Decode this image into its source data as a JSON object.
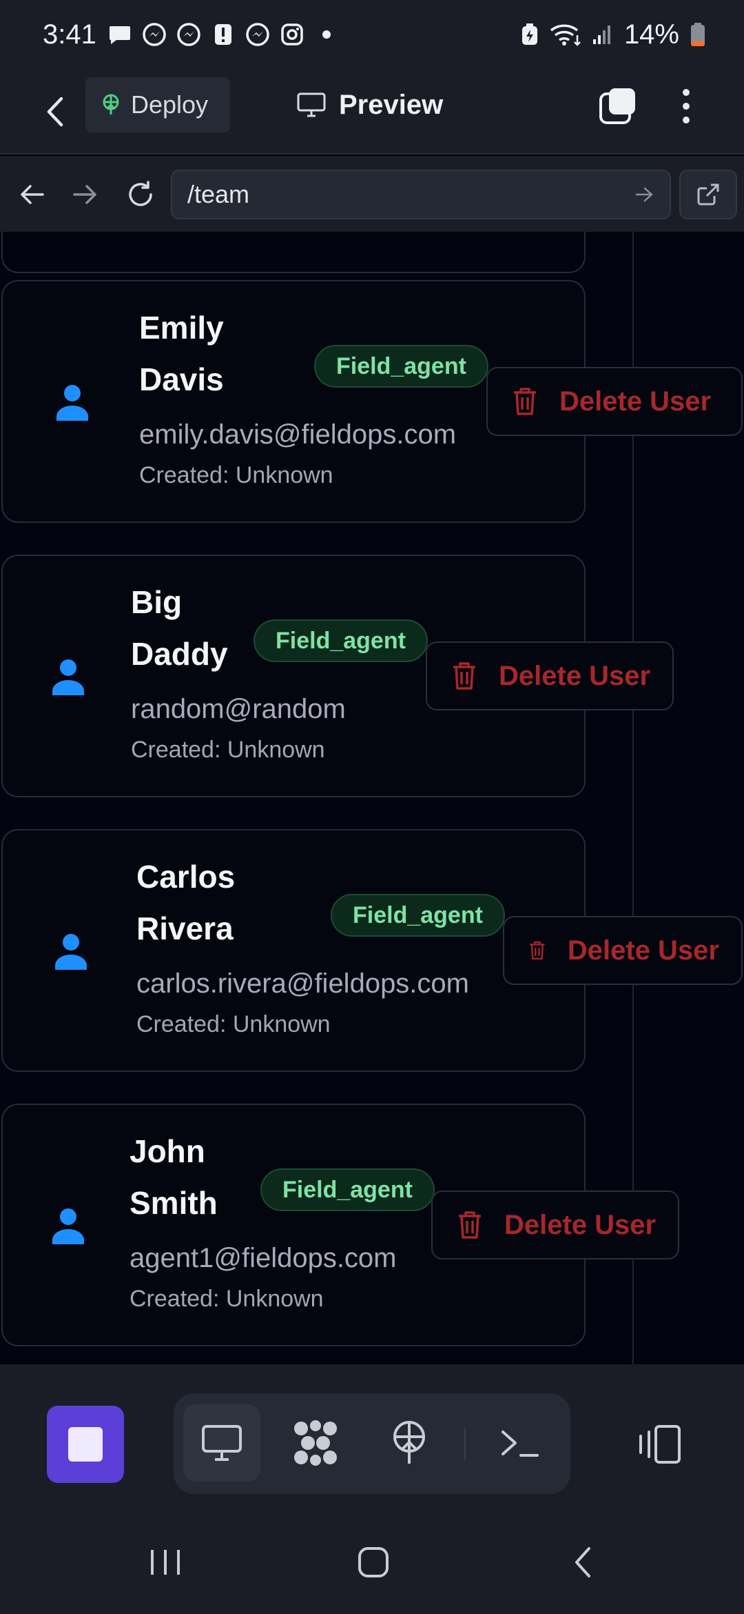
{
  "status_bar": {
    "time": "3:41",
    "notification_icons": [
      "chat-bubble-icon",
      "messenger-icon",
      "messenger-icon",
      "alert-icon",
      "messenger-icon",
      "instagram-icon",
      "dot-icon"
    ],
    "battery_text": "14%"
  },
  "header": {
    "deploy_label": "Deploy",
    "preview_label": "Preview"
  },
  "browser": {
    "url": "/team"
  },
  "users": [
    {
      "name": "Emily\nDavis",
      "role": "Field_agent",
      "email": "emily.davis@fieldops.com",
      "created": "Created: Unknown",
      "delete_label": "Delete User"
    },
    {
      "name": "Big\nDaddy",
      "role": "Field_agent",
      "email": "random@random",
      "created": "Created: Unknown",
      "delete_label": "Delete User"
    },
    {
      "name": "Carlos\nRivera",
      "role": "Field_agent",
      "email": "carlos.rivera@fieldops.com",
      "created": "Created: Unknown",
      "delete_label": "Delete User"
    },
    {
      "name": "John\nSmith",
      "role": "Field_agent",
      "email": "agent1@fieldops.com",
      "created": "Created: Unknown",
      "delete_label": "Delete User"
    }
  ],
  "colors": {
    "accent_purple": "#5b3fd6",
    "role_green": "#7ee3a6",
    "delete_red": "#a8272a",
    "avatar_blue": "#1f8fff"
  }
}
